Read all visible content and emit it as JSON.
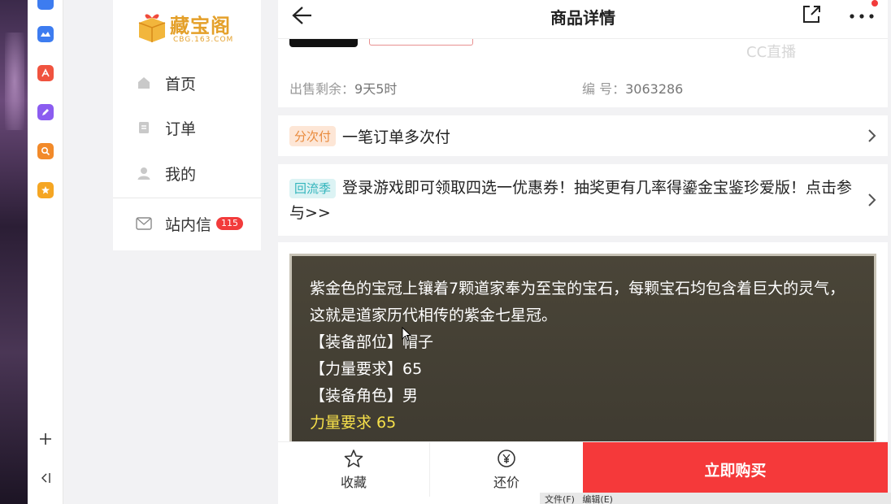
{
  "site": {
    "logo_text": "藏宝阁",
    "logo_sub": "CBG.163.COM"
  },
  "nav": {
    "items": [
      {
        "label": "首页",
        "icon": "home-icon"
      },
      {
        "label": "订单",
        "icon": "order-icon"
      },
      {
        "label": "我的",
        "icon": "user-icon"
      }
    ],
    "inbox": {
      "label": "站内信",
      "badge": "115",
      "icon": "mail-icon"
    }
  },
  "header": {
    "title": "商品详情"
  },
  "meta": {
    "remaining_label": "出售剩余：",
    "remaining_value": "9天5时",
    "id_label": "编 号：",
    "id_value": "3063286"
  },
  "watermark": "CC直播",
  "promo_installment": {
    "tag": "分次付",
    "text": "一笔订单多次付"
  },
  "promo_return": {
    "tag": "回流季",
    "text": "登录游戏即可领取四选一优惠券！抽奖更有几率得鎏金宝鉴珍爱版！点击参与>>"
  },
  "description": {
    "intro": "紫金色的宝冠上镶着7颗道家奉为至宝的宝石，每颗宝石均包含着巨大的灵气，这就是道家历代相传的紫金七星冠。",
    "lines": [
      "【装备部位】帽子",
      "【力量要求】65",
      "【装备角色】男"
    ],
    "highlight": "力量要求 65"
  },
  "bottom": {
    "favorite_label": "收藏",
    "bargain_label": "还价",
    "buy_label": "立即购买"
  },
  "taskbar": {
    "items": [
      "文件(F)",
      "编辑(E)"
    ]
  },
  "colors": {
    "accent_red": "#f5393a",
    "logo_gold": "#e4a02a",
    "desc_bg": "#4a4538",
    "highlight_yellow": "#f6e04a"
  }
}
